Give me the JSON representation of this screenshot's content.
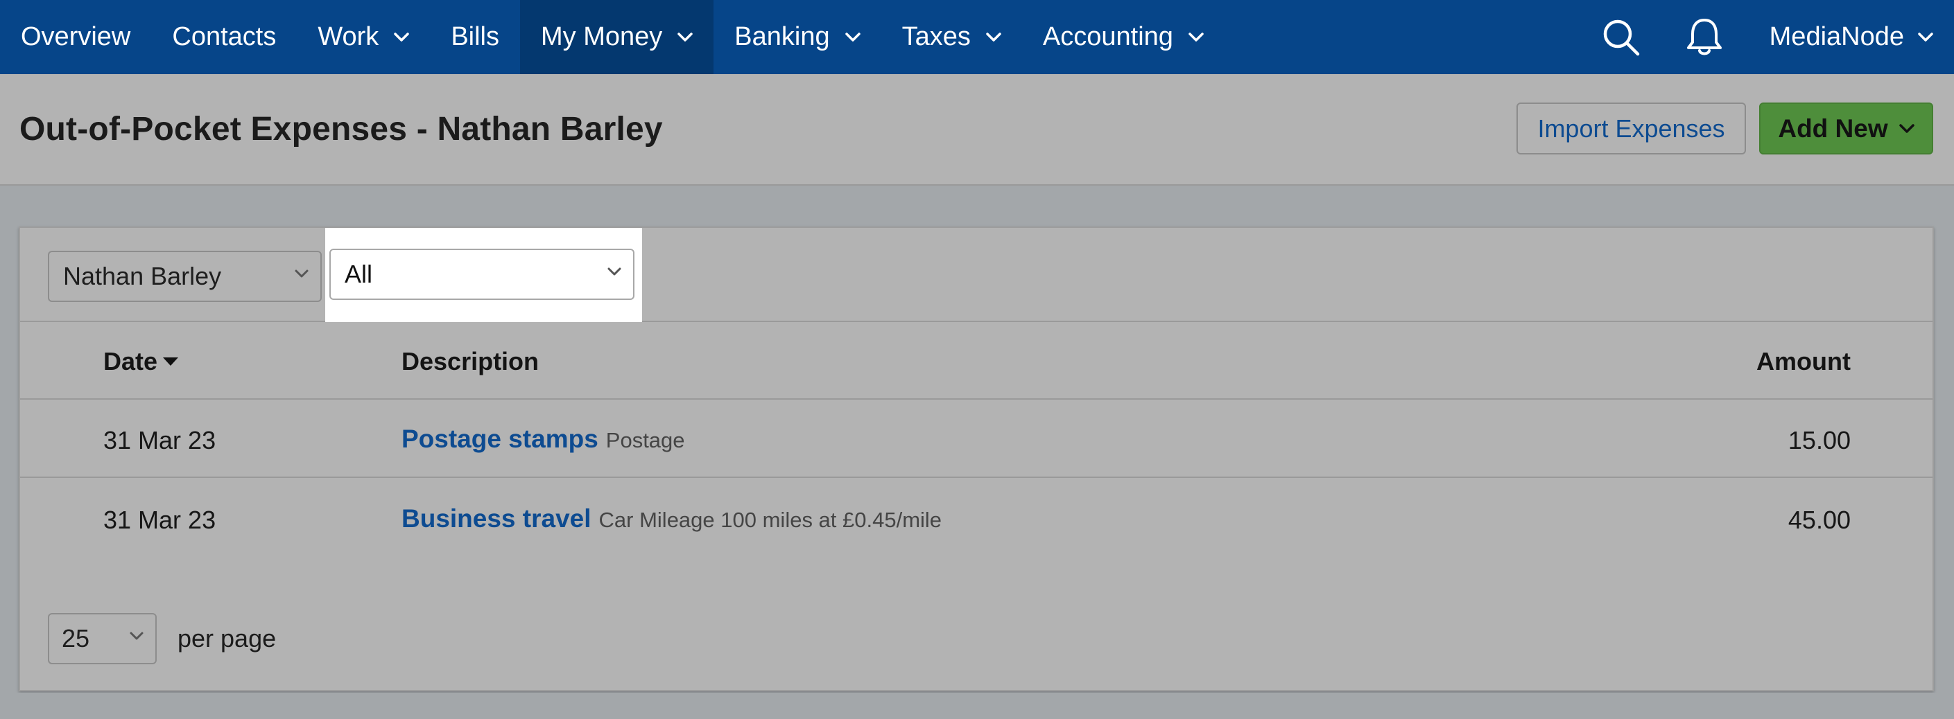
{
  "nav": {
    "items": [
      {
        "label": "Overview",
        "dropdown": false,
        "active": false
      },
      {
        "label": "Contacts",
        "dropdown": false,
        "active": false
      },
      {
        "label": "Work",
        "dropdown": true,
        "active": false
      },
      {
        "label": "Bills",
        "dropdown": false,
        "active": false
      },
      {
        "label": "My Money",
        "dropdown": true,
        "active": true
      },
      {
        "label": "Banking",
        "dropdown": true,
        "active": false
      },
      {
        "label": "Taxes",
        "dropdown": true,
        "active": false
      },
      {
        "label": "Accounting",
        "dropdown": true,
        "active": false
      }
    ],
    "icons": {
      "search": "search-icon",
      "notifications": "bell-icon"
    },
    "account_label": "MediaNode"
  },
  "header": {
    "title": "Out-of-Pocket Expenses - Nathan Barley",
    "import_label": "Import Expenses",
    "add_new_label": "Add New"
  },
  "filters": {
    "person_selected": "Nathan Barley",
    "type_selected": "All"
  },
  "table": {
    "columns": {
      "date": "Date",
      "description": "Description",
      "amount": "Amount"
    },
    "rows": [
      {
        "date": "31 Mar 23",
        "title": "Postage stamps",
        "detail": "Postage",
        "amount": "15.00"
      },
      {
        "date": "31 Mar 23",
        "title": "Business travel",
        "detail": "Car Mileage 100 miles at £0.45/mile",
        "amount": "45.00"
      }
    ]
  },
  "pagination": {
    "per_page_value": "25",
    "per_page_label": "per page"
  },
  "colors": {
    "nav_bg": "#064589",
    "nav_active": "#04386f",
    "link": "#0d4b91",
    "add_button": "#4e8e3b",
    "overlay_bg": "#b3b3b3"
  }
}
